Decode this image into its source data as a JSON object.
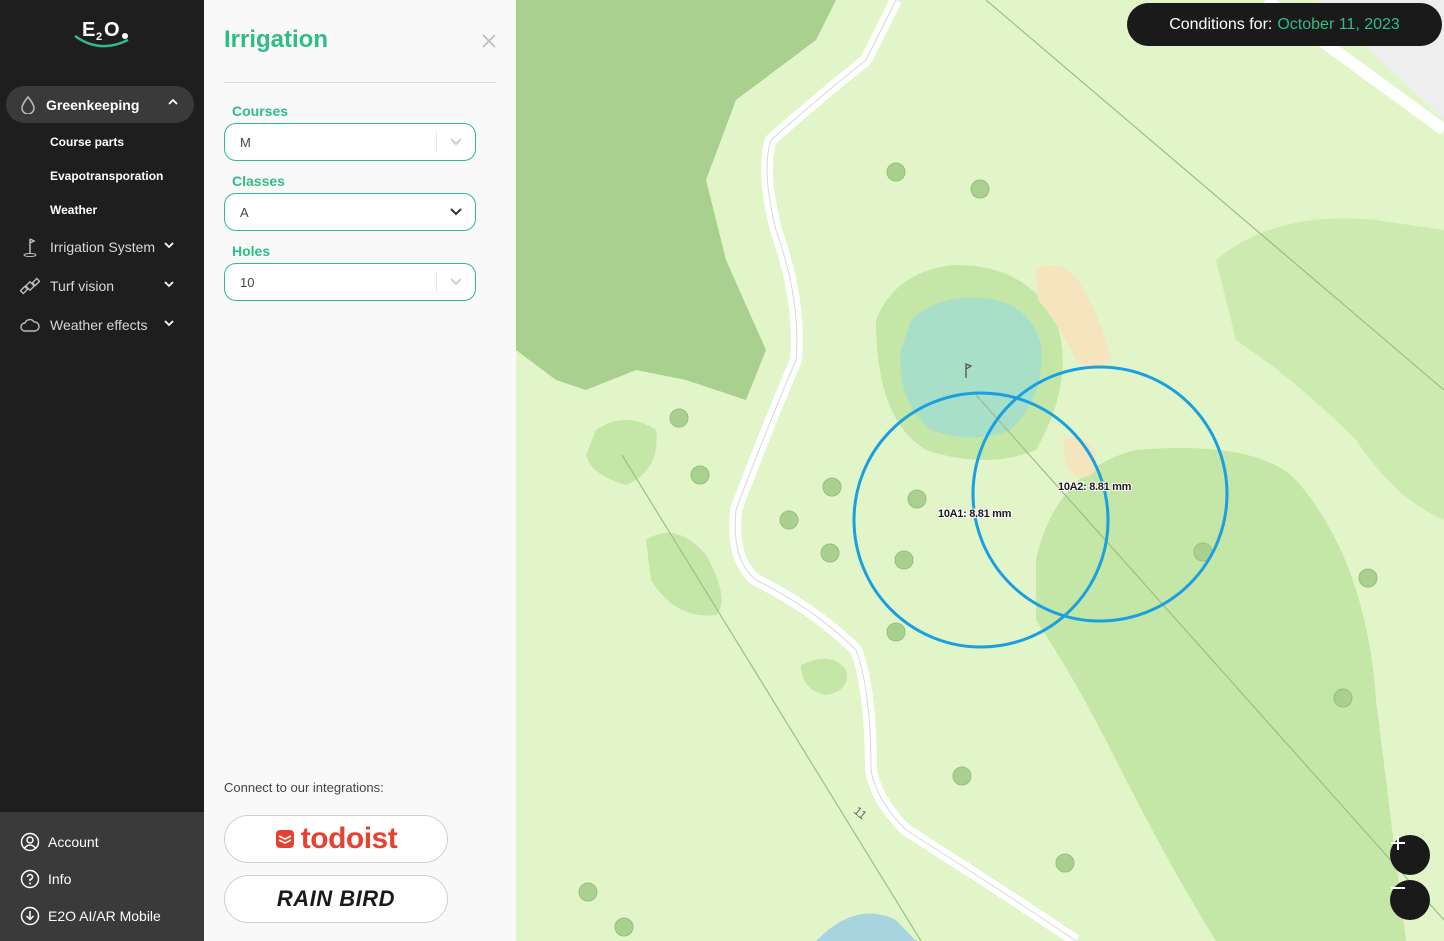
{
  "sidebar": {
    "logo_text": "E2O",
    "nav_main": {
      "label": "Greenkeeping",
      "icon": "droplet-icon"
    },
    "sub_items": [
      "Course parts",
      "Evapotransporation",
      "Weather"
    ],
    "nav_items": [
      {
        "label": "Irrigation System",
        "icon": "golf-flag-icon"
      },
      {
        "label": "Turf vision",
        "icon": "satellite-icon"
      },
      {
        "label": "Weather effects",
        "icon": "cloud-icon"
      }
    ],
    "bottom_items": [
      {
        "label": "Account",
        "icon": "user-circle-icon"
      },
      {
        "label": "Info",
        "icon": "question-circle-icon"
      },
      {
        "label": "E2O AI/AR Mobile",
        "icon": "download-circle-icon"
      }
    ]
  },
  "panel": {
    "title": "Irrigation",
    "fields": [
      {
        "label": "Courses",
        "value": "M"
      },
      {
        "label": "Classes",
        "value": "A"
      },
      {
        "label": "Holes",
        "value": "10"
      }
    ],
    "integrations_label": "Connect to our integrations:",
    "integrations": [
      "todoist",
      "RAIN BIRD"
    ]
  },
  "map": {
    "conditions_prefix": "Conditions for:",
    "conditions_date": "October 11, 2023",
    "sprinklers": [
      {
        "label": "10A1: 8.81 mm"
      },
      {
        "label": "10A2: 8.81 mm"
      }
    ],
    "hole_number": "11",
    "colors": {
      "accent": "#2ebd85",
      "sprinkler_circle": "#1a9fe0",
      "forest": "#a9d08f",
      "fairway": "#c4e6a6",
      "green": "#a8dfc8",
      "bunker": "#f5e4bd"
    }
  }
}
